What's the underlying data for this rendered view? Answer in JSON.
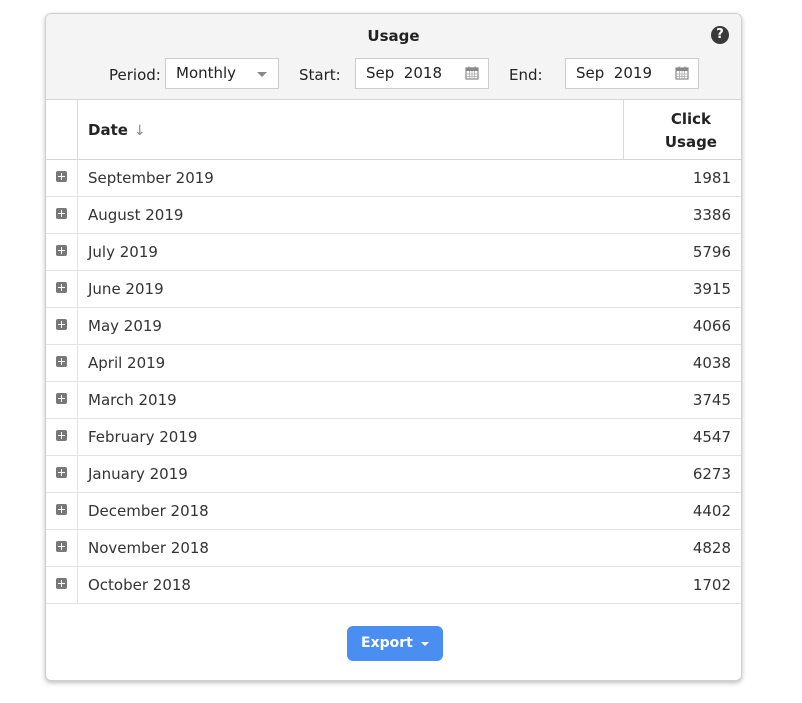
{
  "header": {
    "title": "Usage",
    "help_icon": "?"
  },
  "controls": {
    "period_label": "Period:",
    "period_value": "Monthly",
    "start_label": "Start:",
    "start_value": "Sep  2018",
    "end_label": "End:",
    "end_value": "Sep  2019"
  },
  "table": {
    "columns": {
      "date": "Date",
      "sort_indicator": "↓",
      "usage_line1": "Click",
      "usage_line2": "Usage"
    },
    "rows": [
      {
        "date": "September 2019",
        "usage": "1981"
      },
      {
        "date": "August 2019",
        "usage": "3386"
      },
      {
        "date": "July 2019",
        "usage": "5796"
      },
      {
        "date": "June 2019",
        "usage": "3915"
      },
      {
        "date": "May 2019",
        "usage": "4066"
      },
      {
        "date": "April 2019",
        "usage": "4038"
      },
      {
        "date": "March 2019",
        "usage": "3745"
      },
      {
        "date": "February 2019",
        "usage": "4547"
      },
      {
        "date": "January 2019",
        "usage": "6273"
      },
      {
        "date": "December 2018",
        "usage": "4402"
      },
      {
        "date": "November 2018",
        "usage": "4828"
      },
      {
        "date": "October 2018",
        "usage": "1702"
      }
    ]
  },
  "footer": {
    "export_label": "Export"
  },
  "colors": {
    "accent": "#4a8ef2",
    "header_bg": "#f4f4f4"
  },
  "icons": {
    "help": "help-icon",
    "calendar": "calendar-icon",
    "expand": "plus-icon",
    "dropdown": "chevron-down-icon",
    "sort": "arrow-down-icon"
  }
}
